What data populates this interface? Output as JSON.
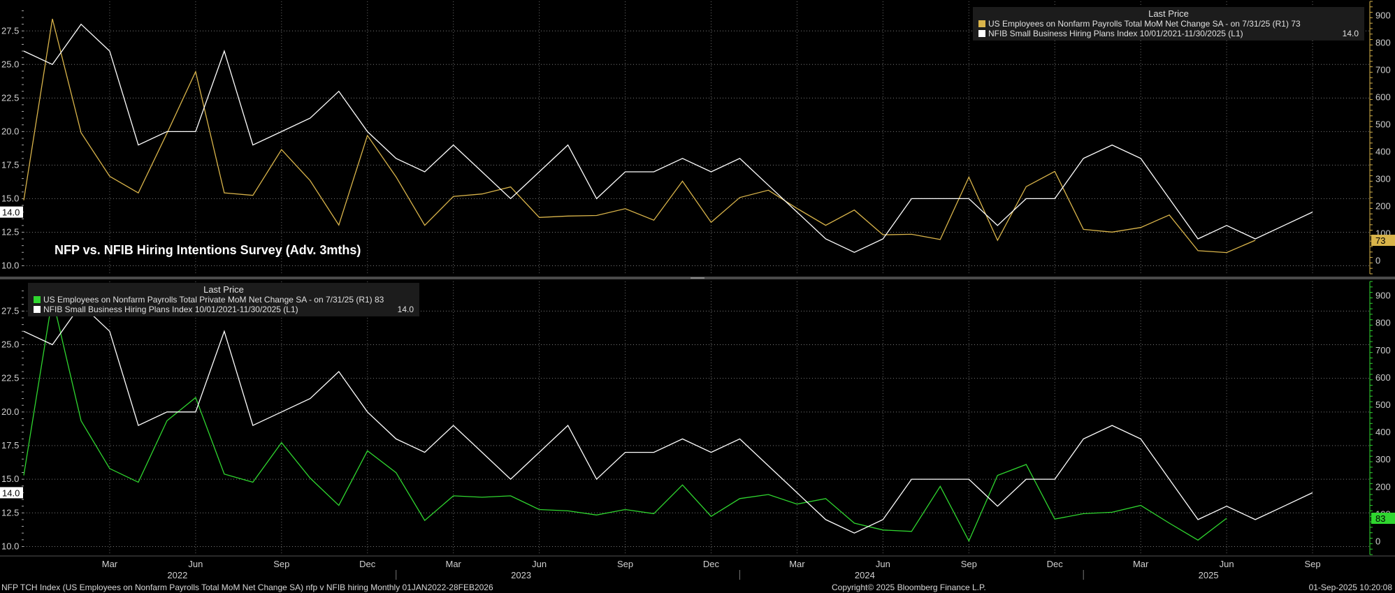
{
  "chart_data": [
    {
      "type": "line",
      "title": "NFP vs. NFIB Hiring Intentions Survey (Adv. 3mths)",
      "legend_header": "Last Price",
      "legend_placement": "top-right",
      "grid": true,
      "x": [
        "2021-12",
        "2022-01",
        "2022-02",
        "2022-03",
        "2022-04",
        "2022-05",
        "2022-06",
        "2022-07",
        "2022-08",
        "2022-09",
        "2022-10",
        "2022-11",
        "2022-12",
        "2023-01",
        "2023-02",
        "2023-03",
        "2023-04",
        "2023-05",
        "2023-06",
        "2023-07",
        "2023-08",
        "2023-09",
        "2023-10",
        "2023-11",
        "2023-12",
        "2024-01",
        "2024-02",
        "2024-03",
        "2024-04",
        "2024-05",
        "2024-06",
        "2024-07",
        "2024-08",
        "2024-09",
        "2024-10",
        "2024-11",
        "2024-12",
        "2025-01",
        "2025-02",
        "2025-03",
        "2025-04",
        "2025-05",
        "2025-06",
        "2025-07",
        "2025-08",
        "2025-09",
        "2025-10",
        "2025-11"
      ],
      "left_axis": {
        "ticks": [
          "10.0",
          "12.5",
          "15.0",
          "17.5",
          "20.0",
          "22.5",
          "25.0",
          "27.5"
        ],
        "ylim": [
          9.4,
          29.7
        ]
      },
      "right_axis": {
        "ticks": [
          "0",
          "100",
          "200",
          "300",
          "400",
          "500",
          "600",
          "700",
          "800",
          "900"
        ],
        "ylim": [
          -50,
          950
        ]
      },
      "series": [
        {
          "name": "US Employees on Nonfarm Payrolls Total MoM Net Change SA -  on 7/31/25  (R1) 73",
          "axis": "right",
          "color": "#d9b44a",
          "last": "73",
          "values": [
            220,
            886,
            468,
            308,
            247,
            466,
            692,
            247,
            238,
            406,
            292,
            129,
            458,
            306,
            128,
            234,
            243,
            269,
            157,
            162,
            164,
            189,
            147,
            290,
            139,
            230,
            257,
            190,
            128,
            184,
            93,
            95,
            76,
            305,
            73,
            270,
            326,
            113,
            103,
            120,
            166,
            35,
            28,
            73,
            null,
            null,
            null,
            null
          ]
        },
        {
          "name": "NFIB Small Business Hiring Plans Index 10/01/2021-11/30/2025  (L1)",
          "axis": "left",
          "color": "#ffffff",
          "last": "14.0",
          "values": [
            26,
            25,
            28,
            26,
            19,
            20,
            20,
            26,
            19,
            20,
            21,
            23,
            20,
            18,
            17,
            19,
            17,
            15,
            17,
            19,
            15,
            17,
            17,
            18,
            17,
            18,
            16,
            14,
            12,
            11,
            12,
            15,
            15,
            15,
            13,
            15,
            15,
            18,
            19,
            18,
            15,
            12,
            13,
            12,
            13,
            14,
            null,
            null
          ]
        }
      ]
    },
    {
      "type": "line",
      "title": "",
      "legend_header": "Last Price",
      "legend_placement": "top-left",
      "grid": true,
      "x": [
        "2021-12",
        "2022-01",
        "2022-02",
        "2022-03",
        "2022-04",
        "2022-05",
        "2022-06",
        "2022-07",
        "2022-08",
        "2022-09",
        "2022-10",
        "2022-11",
        "2022-12",
        "2023-01",
        "2023-02",
        "2023-03",
        "2023-04",
        "2023-05",
        "2023-06",
        "2023-07",
        "2023-08",
        "2023-09",
        "2023-10",
        "2023-11",
        "2023-12",
        "2024-01",
        "2024-02",
        "2024-03",
        "2024-04",
        "2024-05",
        "2024-06",
        "2024-07",
        "2024-08",
        "2024-09",
        "2024-10",
        "2024-11",
        "2024-12",
        "2025-01",
        "2025-02",
        "2025-03",
        "2025-04",
        "2025-05",
        "2025-06",
        "2025-07",
        "2025-08",
        "2025-09",
        "2025-10",
        "2025-11"
      ],
      "left_axis": {
        "ticks": [
          "10.0",
          "12.5",
          "15.0",
          "17.5",
          "20.0",
          "22.5",
          "25.0",
          "27.5"
        ],
        "ylim": [
          9.4,
          29.7
        ]
      },
      "right_axis": {
        "ticks": [
          "0",
          "100",
          "200",
          "300",
          "400",
          "500",
          "600",
          "700",
          "800",
          "900"
        ],
        "ylim": [
          -50,
          950
        ]
      },
      "series": [
        {
          "name": "US Employees on Nonfarm Payrolls Total Private MoM Net Change SA -  on 7/31/25  (R1) 83",
          "axis": "right",
          "color": "#2fd62f",
          "last": "83",
          "values": [
            240,
            890,
            440,
            265,
            215,
            440,
            525,
            245,
            215,
            360,
            230,
            130,
            330,
            250,
            75,
            165,
            160,
            165,
            115,
            110,
            95,
            115,
            100,
            205,
            90,
            155,
            170,
            135,
            155,
            65,
            40,
            35,
            200,
            0,
            240,
            280,
            80,
            100,
            105,
            130,
            65,
            3,
            83,
            null,
            null,
            null,
            null,
            null
          ]
        },
        {
          "name": "NFIB Small Business Hiring Plans Index 10/01/2021-11/30/2025  (L1)",
          "axis": "left",
          "color": "#ffffff",
          "last": "14.0",
          "values": [
            26,
            25,
            28,
            26,
            19,
            20,
            20,
            26,
            19,
            20,
            21,
            23,
            20,
            18,
            17,
            19,
            17,
            15,
            17,
            19,
            15,
            17,
            17,
            18,
            17,
            18,
            16,
            14,
            12,
            11,
            12,
            15,
            15,
            15,
            13,
            15,
            15,
            18,
            19,
            18,
            15,
            12,
            13,
            12,
            13,
            14,
            null,
            null
          ]
        }
      ],
      "x_tick_labels": [
        {
          "x": "2022-03",
          "label": "Mar"
        },
        {
          "x": "2022-06",
          "label": "Jun"
        },
        {
          "x": "2022-09",
          "label": "Sep"
        },
        {
          "x": "2022-12",
          "label": "Dec"
        },
        {
          "x": "2023-03",
          "label": "Mar"
        },
        {
          "x": "2023-06",
          "label": "Jun"
        },
        {
          "x": "2023-09",
          "label": "Sep"
        },
        {
          "x": "2023-12",
          "label": "Dec"
        },
        {
          "x": "2024-03",
          "label": "Mar"
        },
        {
          "x": "2024-06",
          "label": "Jun"
        },
        {
          "x": "2024-09",
          "label": "Sep"
        },
        {
          "x": "2024-12",
          "label": "Dec"
        },
        {
          "x": "2025-03",
          "label": "Mar"
        },
        {
          "x": "2025-06",
          "label": "Jun"
        },
        {
          "x": "2025-09",
          "label": "Sep"
        }
      ],
      "year_labels": [
        {
          "x": "2022-06",
          "label": "2022"
        },
        {
          "x": "2023-06",
          "label": "2023"
        },
        {
          "x": "2024-06",
          "label": "2024"
        },
        {
          "x": "2025-06",
          "label": "2025"
        }
      ]
    }
  ],
  "footer": {
    "left": "NFP TCH Index (US Employees on Nonfarm Payrolls Total MoM Net Change SA) nfp v NFIB hiring  Monthly 01JAN2022-28FEB2026",
    "center": "Copyright© 2025 Bloomberg Finance L.P.",
    "right": "01-Sep-2025 10:20:08"
  }
}
